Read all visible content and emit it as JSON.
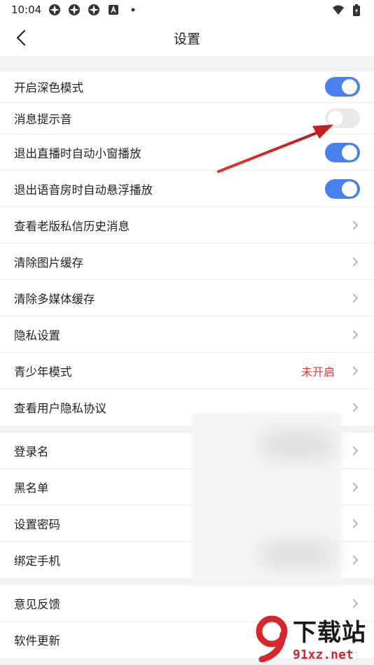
{
  "status_bar": {
    "time": "10:04",
    "icons": [
      "app-icon",
      "app-icon",
      "app-icon",
      "a-badge-icon",
      "dot-icon"
    ],
    "right_icons": [
      "wifi-icon",
      "battery-icon"
    ]
  },
  "nav": {
    "title": "设置",
    "back_icon": "chevron-left-icon"
  },
  "groups": [
    {
      "items": [
        {
          "label": "开启深色模式",
          "control": "toggle",
          "state": "on"
        },
        {
          "label": "消息提示音",
          "control": "toggle",
          "state": "off"
        },
        {
          "label": "退出直播时自动小窗播放",
          "control": "toggle",
          "state": "on"
        },
        {
          "label": "退出语音房时自动悬浮播放",
          "control": "toggle",
          "state": "on"
        },
        {
          "label": "查看老版私信历史消息",
          "control": "chevron"
        },
        {
          "label": "清除图片缓存",
          "control": "chevron"
        },
        {
          "label": "清除多媒体缓存",
          "control": "chevron"
        },
        {
          "label": "隐私设置",
          "control": "chevron"
        },
        {
          "label": "青少年模式",
          "control": "chevron",
          "value": "未开启"
        },
        {
          "label": "查看用户隐私协议",
          "control": "chevron"
        }
      ]
    },
    {
      "items": [
        {
          "label": "登录名",
          "control": "chevron"
        },
        {
          "label": "黑名单",
          "control": "chevron"
        },
        {
          "label": "设置密码",
          "control": "chevron"
        },
        {
          "label": "绑定手机",
          "control": "chevron"
        }
      ]
    },
    {
      "items": [
        {
          "label": "意见反馈",
          "control": "chevron"
        },
        {
          "label": "软件更新",
          "control": "chevron"
        }
      ]
    }
  ],
  "colors": {
    "toggle_on": "#4a7ff0",
    "toggle_off": "#e9e9e9",
    "value_red": "#e53935",
    "annotation_arrow": "#d9231f"
  },
  "watermark": {
    "text": "下载站",
    "url": "91xz.net"
  }
}
